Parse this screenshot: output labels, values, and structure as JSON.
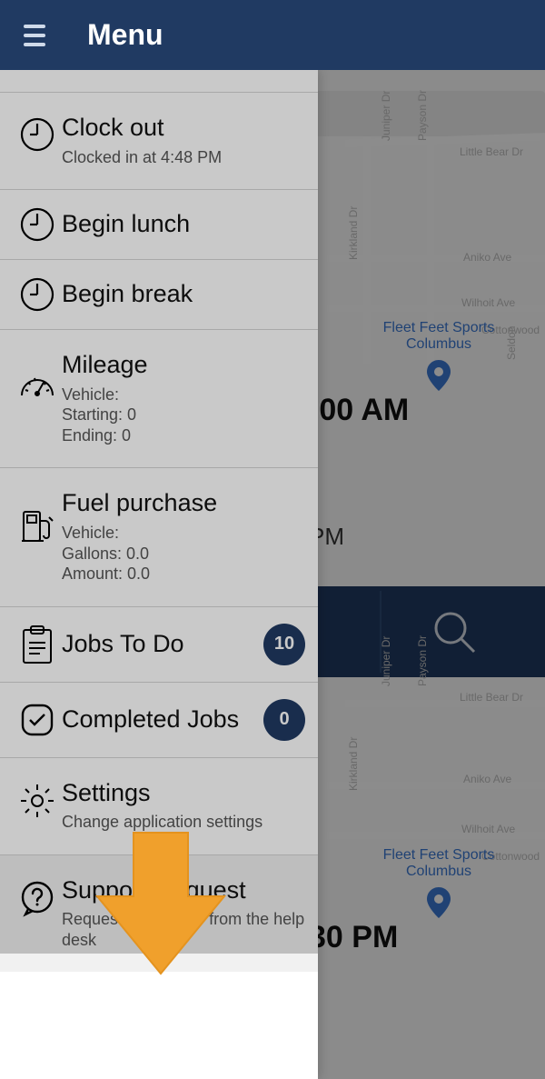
{
  "header": {
    "title": "Menu"
  },
  "menu": {
    "clock_out": {
      "title": "Clock out",
      "subtitle": "Clocked in at 4:48 PM"
    },
    "begin_lunch": {
      "title": "Begin lunch"
    },
    "begin_break": {
      "title": "Begin break"
    },
    "mileage": {
      "title": "Mileage",
      "line1": "Vehicle:",
      "line2": "Starting: 0",
      "line3": "Ending: 0"
    },
    "fuel": {
      "title": "Fuel purchase",
      "line1": "Vehicle:",
      "line2": "Gallons: 0.0",
      "line3": "Amount: 0.0"
    },
    "jobs_todo": {
      "title": "Jobs To Do",
      "badge": "10"
    },
    "jobs_done": {
      "title": "Completed Jobs",
      "badge": "0"
    },
    "settings": {
      "title": "Settings",
      "subtitle": "Change application settings"
    },
    "support": {
      "title": "Support Request",
      "subtitle": "Request assistance from the help desk"
    }
  },
  "background": {
    "time_peek1": ":00 AM",
    "time_peek2": "PM",
    "time_peek3": "30 PM",
    "map_poi1_line1": "Fleet Feet Sports",
    "map_poi1_line2": "Columbus",
    "street_juniper": "Juniper Dr",
    "street_payson": "Payson Dr",
    "street_littlebear": "Little Bear Dr",
    "street_aniko": "Aniko Ave",
    "street_wilhoit": "Wilhoit Ave",
    "street_cottonwood": "Cottonwood",
    "street_seldon": "Seldon",
    "street_kirkland": "Kirkland Dr"
  },
  "colors": {
    "brand": "#203a62",
    "accent": "#f0a02c"
  }
}
